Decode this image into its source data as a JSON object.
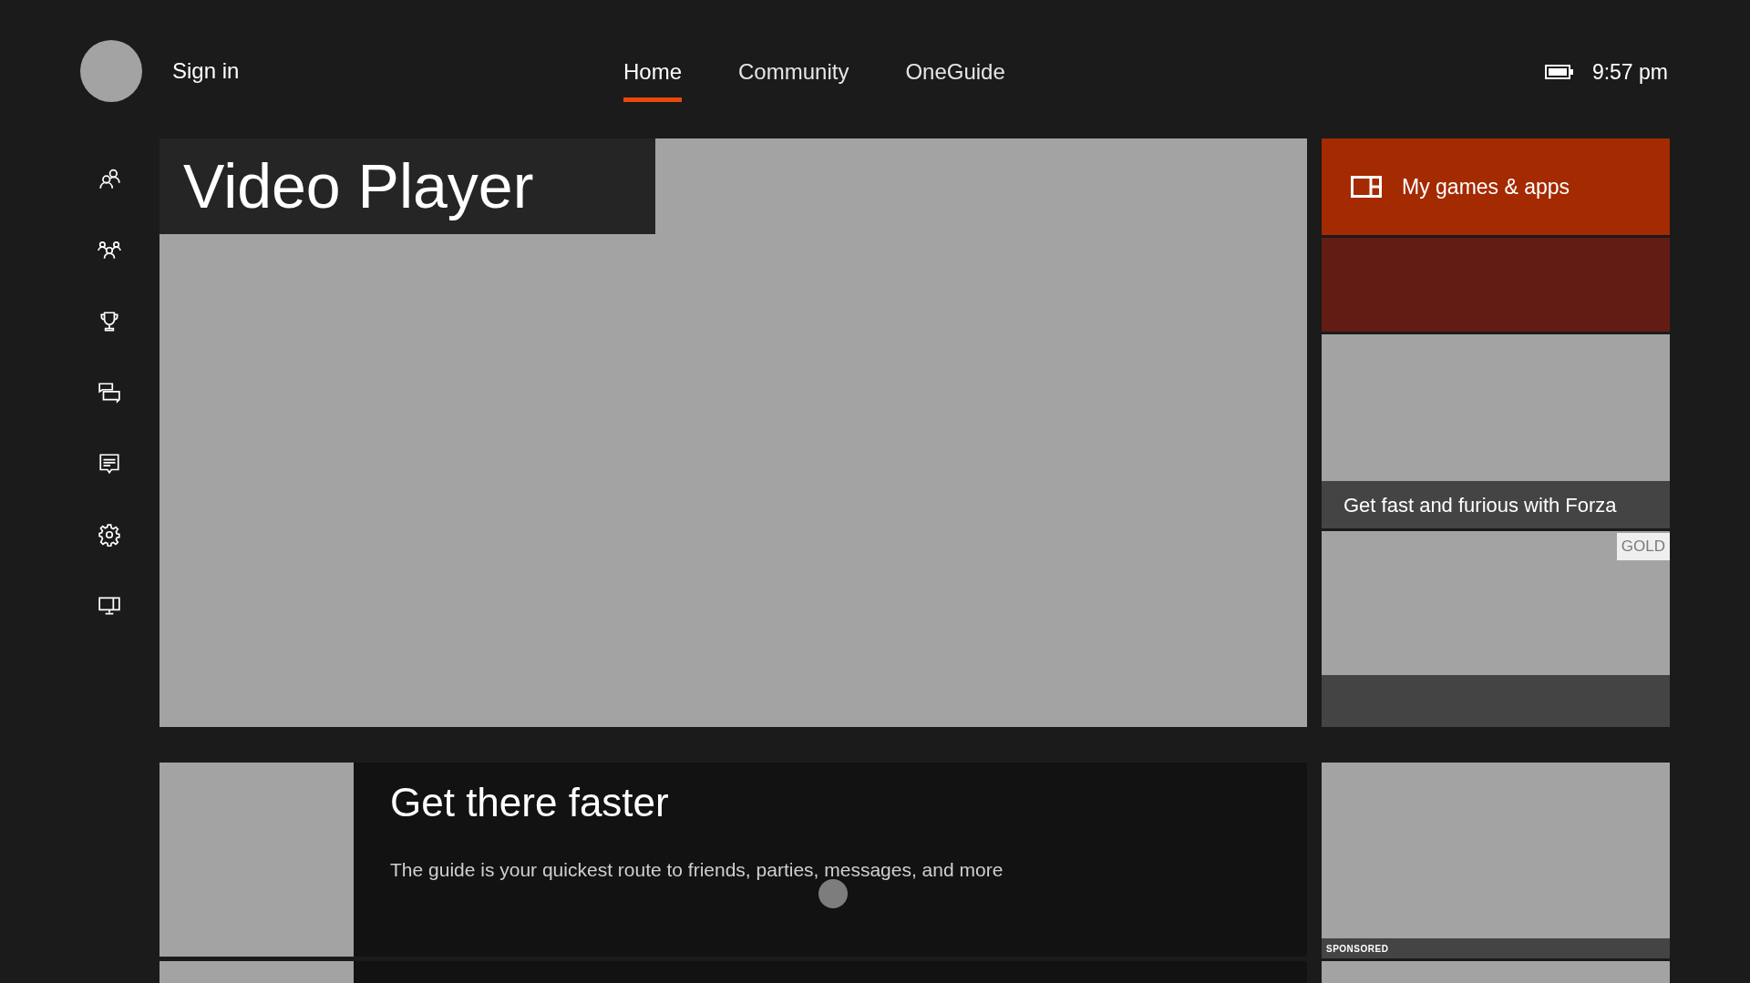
{
  "header": {
    "sign_in": "Sign in",
    "time": "9:57 pm"
  },
  "tabs": [
    {
      "label": "Home",
      "selected": true
    },
    {
      "label": "Community",
      "selected": false
    },
    {
      "label": "OneGuide",
      "selected": false
    }
  ],
  "sidebar_icons": [
    {
      "kind": "friends"
    },
    {
      "kind": "party"
    },
    {
      "kind": "achievements"
    },
    {
      "kind": "messages"
    },
    {
      "kind": "notifications"
    },
    {
      "kind": "settings"
    },
    {
      "kind": "snap"
    }
  ],
  "hero": {
    "title": "Video Player"
  },
  "side_tiles": {
    "games_apps": "My games & apps",
    "promo_caption": "Get fast and furious with Forza",
    "gold_badge": "GOLD",
    "sponsored_label": "SPONSORED"
  },
  "guide": {
    "title": "Get there faster",
    "text": "The guide is your quickest route to friends, parties, messages, and more"
  }
}
